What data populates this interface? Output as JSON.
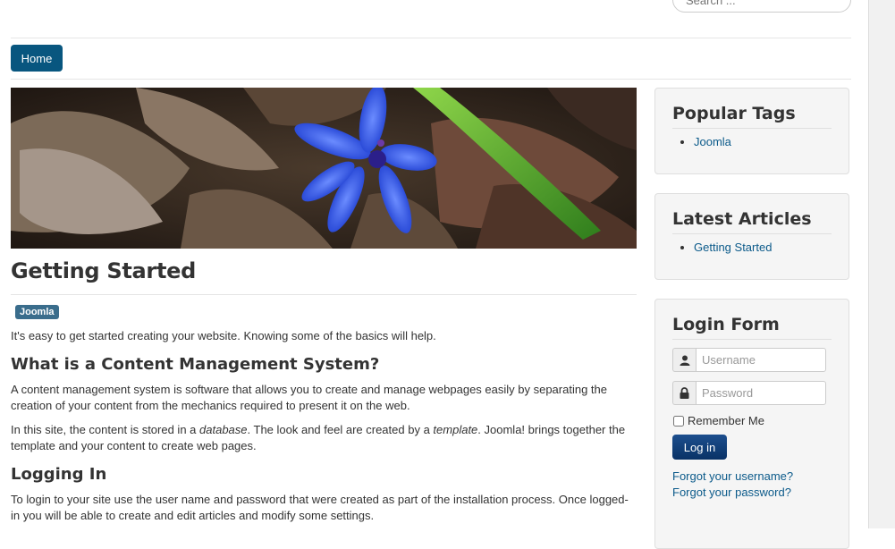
{
  "header": {
    "search_placeholder": "Search ..."
  },
  "nav": {
    "home_label": "Home"
  },
  "article": {
    "title": "Getting Started",
    "tag": "Joomla",
    "intro": "It's easy to get started creating your website. Knowing some of the basics will help.",
    "cms_heading": "What is a Content Management System?",
    "cms_p1": "A content management system is software that allows you to create and manage webpages easily by separating the creation of your content from the mechanics required to present it on the web.",
    "cms_p2_a": "In this site, the content is stored in a ",
    "cms_p2_db": "database",
    "cms_p2_b": ". The look and feel are created by a ",
    "cms_p2_tpl": "template",
    "cms_p2_c": ". Joomla! brings together the template and your content to create web pages.",
    "login_heading": "Logging In",
    "login_p": "To login to your site use the user name and password that were created as part of the installation process. Once logged-in you will be able to create and edit articles and modify some settings."
  },
  "popular_tags": {
    "title": "Popular Tags",
    "items": [
      "Joomla"
    ]
  },
  "latest_articles": {
    "title": "Latest Articles",
    "items": [
      "Getting Started"
    ]
  },
  "login_form": {
    "title": "Login Form",
    "username_placeholder": "Username",
    "password_placeholder": "Password",
    "remember_label": "Remember Me",
    "login_button": "Log in",
    "forgot_username": "Forgot your username?",
    "forgot_password": "Forgot your password?"
  },
  "icons": {
    "user": "user-icon",
    "lock": "lock-icon"
  },
  "colors": {
    "accent": "#08567f",
    "link": "#0b5a8a",
    "tag": "#3a6d8c",
    "login_button": "#0d3c78"
  }
}
